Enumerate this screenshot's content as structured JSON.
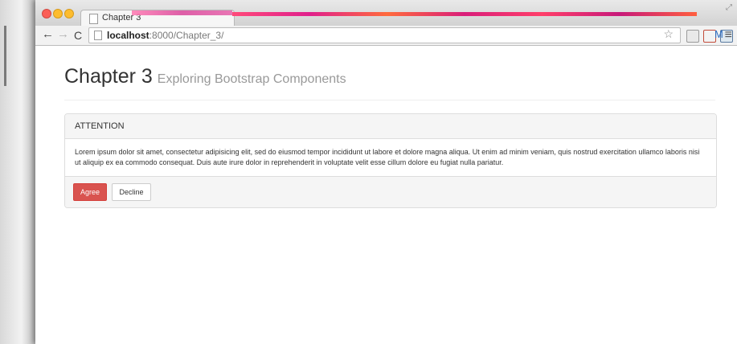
{
  "browser": {
    "tab_title": "Chapter 3",
    "url_host": "localhost",
    "url_path": ":8000/Chapter_3/",
    "ext_m_label": "M"
  },
  "page": {
    "title": "Chapter 3",
    "subtitle": "Exploring Bootstrap Components"
  },
  "panel": {
    "heading": "ATTENTION",
    "body": "Lorem ipsum dolor sit amet, consectetur adipisicing elit, sed do eiusmod tempor incididunt ut labore et dolore magna aliqua. Ut enim ad minim veniam, quis nostrud exercitation ullamco laboris nisi ut aliquip ex ea commodo consequat. Duis aute irure dolor in reprehenderit in voluptate velit esse cillum dolore eu fugiat nulla pariatur.",
    "agree_label": "Agree",
    "decline_label": "Decline"
  },
  "icons": {
    "back": "back-arrow-icon",
    "forward": "forward-arrow-icon",
    "reload": "reload-icon",
    "bookmark": "star-icon",
    "menu": "hamburger-menu-icon"
  }
}
